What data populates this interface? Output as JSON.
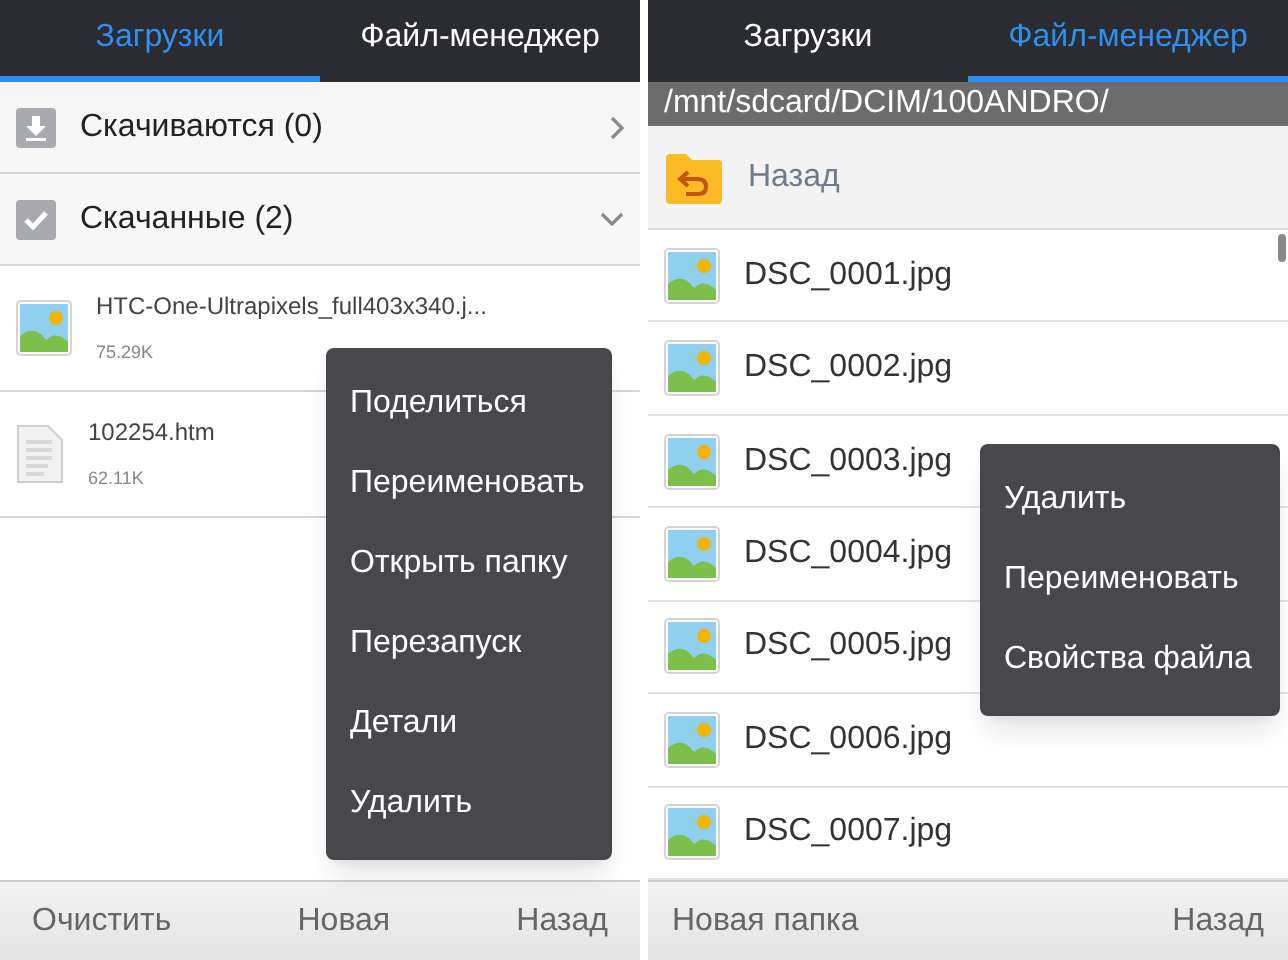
{
  "downloads_screen": {
    "tabs": [
      {
        "label": "Загрузки",
        "selected": true
      },
      {
        "label": "Файл-менеджер",
        "selected": false
      }
    ],
    "sections": [
      {
        "title": "Скачиваются (0)",
        "kind": "downloading",
        "expanded": false
      },
      {
        "title": "Скачанные (2)",
        "kind": "done",
        "expanded": true,
        "files": [
          {
            "name": "HTC-One-Ultrapixels_full403x340.j...",
            "size": "75.29K",
            "kind": "image"
          },
          {
            "name": "102254.htm",
            "size": "62.11K",
            "kind": "document"
          }
        ]
      }
    ],
    "context_menu": [
      "Поделиться",
      "Переименовать",
      "Открыть папку",
      "Перезапуск",
      "Детали",
      "Удалить"
    ],
    "bottom_bar": [
      "Очистить",
      "Новая",
      "Назад"
    ]
  },
  "file_manager_screen": {
    "tabs": [
      {
        "label": "Загрузки",
        "selected": false
      },
      {
        "label": "Файл-менеджер",
        "selected": true
      }
    ],
    "path": "/mnt/sdcard/DCIM/100ANDRO/",
    "back_row": "Назад",
    "files": [
      {
        "name": "DSC_0001.jpg"
      },
      {
        "name": "DSC_0002.jpg"
      },
      {
        "name": "DSC_0003.jpg"
      },
      {
        "name": "DSC_0004.jpg"
      },
      {
        "name": "DSC_0005.jpg"
      },
      {
        "name": "DSC_0006.jpg"
      },
      {
        "name": "DSC_0007.jpg"
      }
    ],
    "context_menu": [
      "Удалить",
      "Переименовать",
      "Свойства файла"
    ],
    "bottom_bar": [
      "Новая папка",
      "Назад"
    ]
  }
}
